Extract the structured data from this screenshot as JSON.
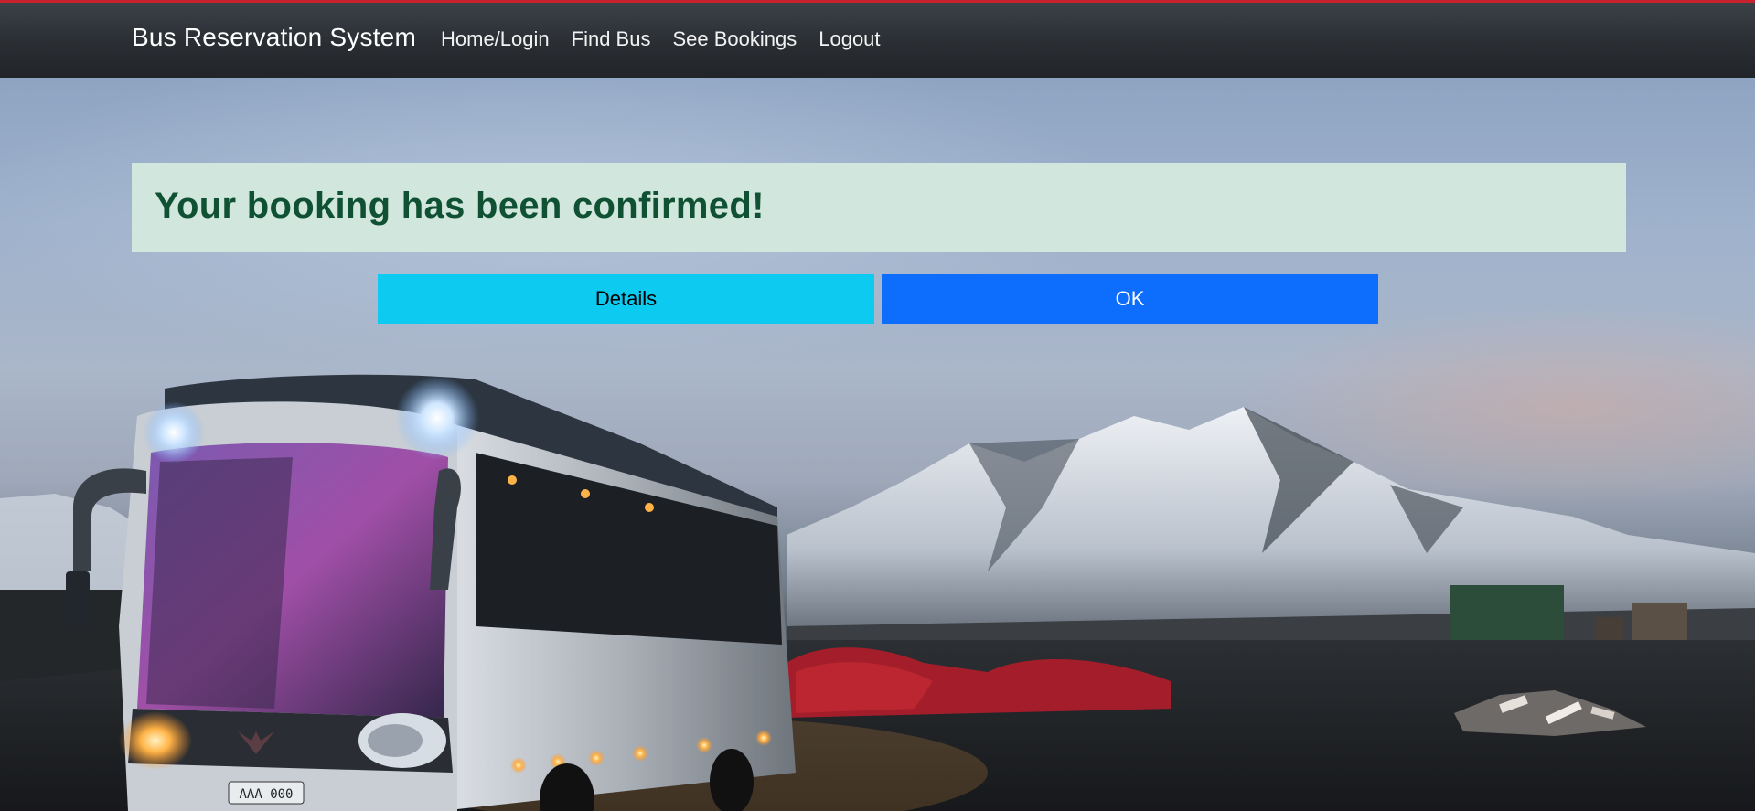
{
  "navbar": {
    "brand": "Bus Reservation System",
    "links": [
      {
        "label": "Home/Login"
      },
      {
        "label": "Find Bus"
      },
      {
        "label": "See Bookings"
      },
      {
        "label": "Logout"
      }
    ]
  },
  "alert": {
    "message": "Your booking has been confirmed!",
    "type": "success",
    "background": "#d1e7dd",
    "text_color": "#0f5132"
  },
  "actions": {
    "details_label": "Details",
    "details_color": "#0dcaf0",
    "ok_label": "OK",
    "ok_color": "#0d6efd"
  },
  "bus": {
    "plate": "AAA 000"
  },
  "theme": {
    "navbar_bg": "#212529",
    "accent_top_border": "#c8232c"
  }
}
